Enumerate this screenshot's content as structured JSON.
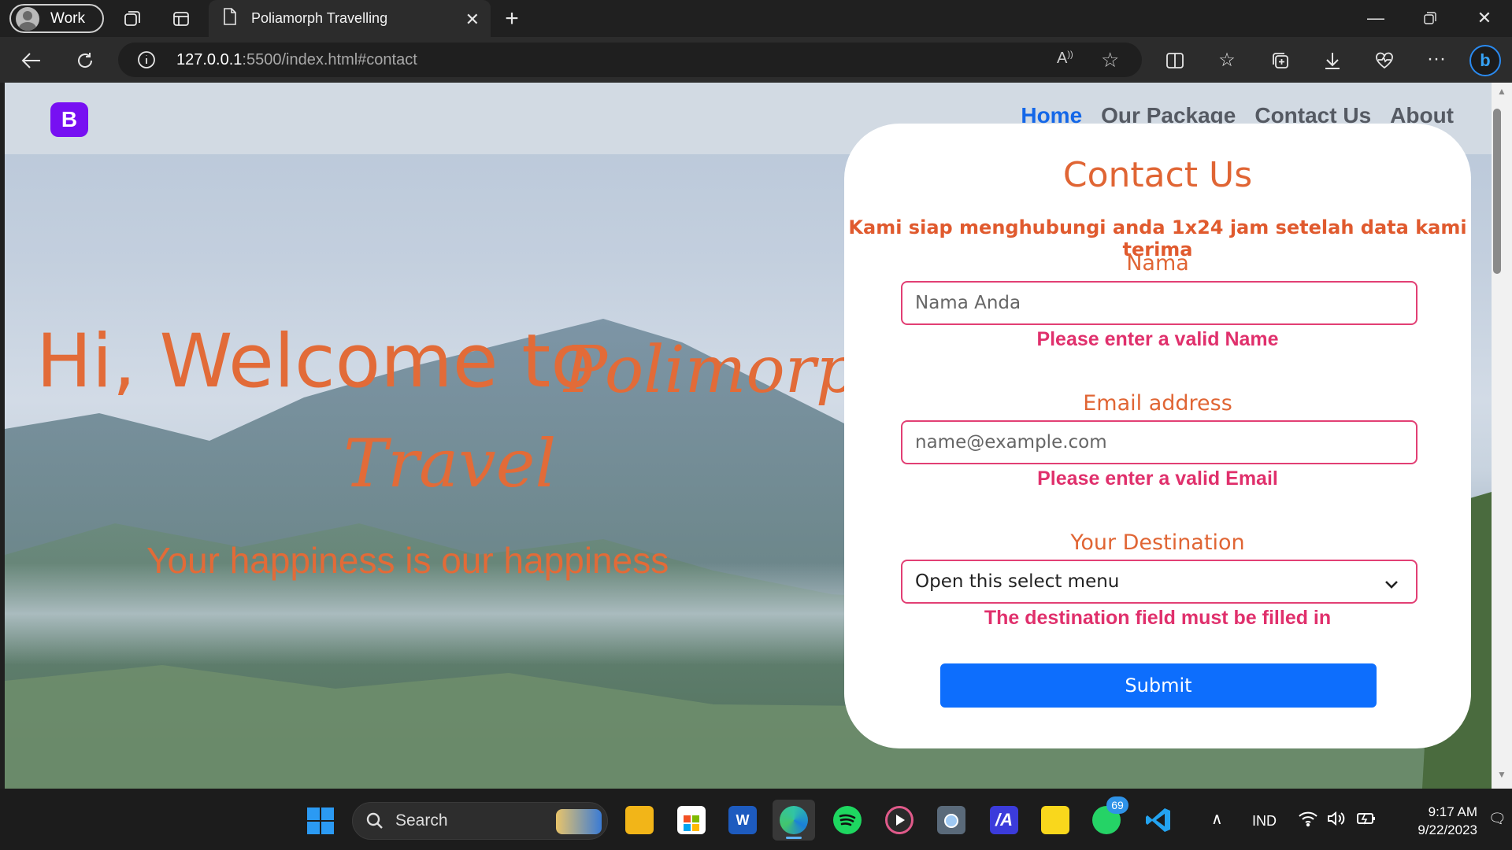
{
  "browser": {
    "profile_label": "Work",
    "tab_title": "Poliamorph Travelling",
    "url_host": "127.0.0.1",
    "url_rest": ":5500/index.html#contact"
  },
  "site": {
    "brand_letter": "B",
    "nav": [
      "Home",
      "Our Package",
      "Contact Us",
      "About"
    ],
    "active_nav": "Home"
  },
  "hero": {
    "greeting": "Hi, Welcome to",
    "brand_line1": "Polimorph",
    "brand_line2": "Travel",
    "subtitle": "Your happiness is our happiness"
  },
  "contact": {
    "title": "Contact Us",
    "subtitle": "Kami siap menghubungi anda 1x24 jam setelah data kami terima",
    "name_label": "Nama",
    "name_placeholder": "Nama Anda",
    "name_error": "Please enter a valid Name",
    "email_label": "Email address",
    "email_placeholder": "name@example.com",
    "email_error": "Please enter a valid Email",
    "dest_label": "Your Destination",
    "dest_selected": "Open this select menu",
    "dest_error": "The destination field must be filled in",
    "submit_label": "Submit"
  },
  "taskbar": {
    "search_label": "Search",
    "whatsapp_badge": "69",
    "language": "IND",
    "time": "9:17 AM",
    "date": "9/22/2023"
  },
  "colors": {
    "accent_orange": "#e26b38",
    "error_pink": "#e0306c",
    "primary_blue": "#0d6efd",
    "brand_purple": "#7710f2"
  }
}
